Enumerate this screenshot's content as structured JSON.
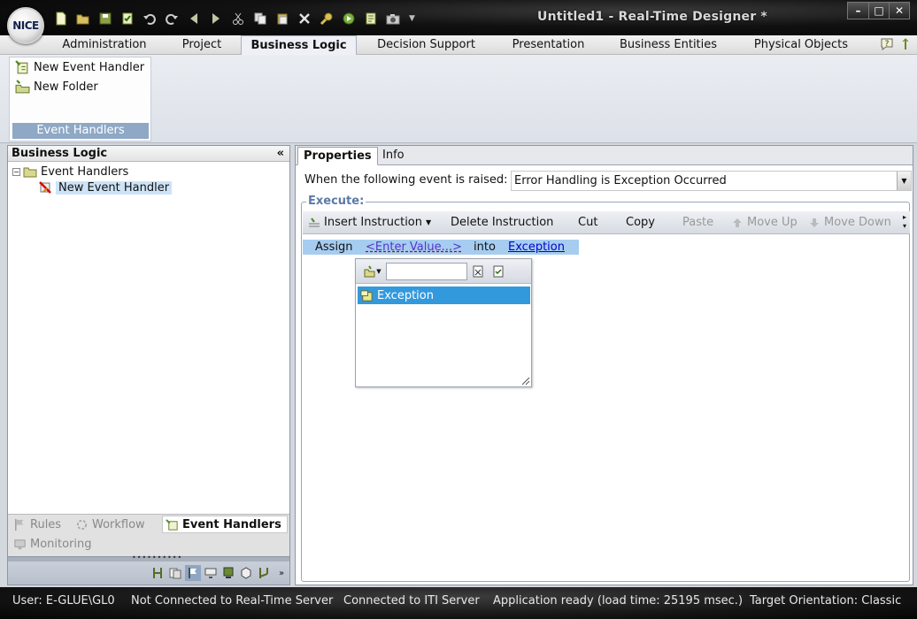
{
  "app": {
    "logo_text": "NICE",
    "window_title": "Untitled1 - Real-Time Designer *"
  },
  "quick_access": {
    "icons": [
      "new-icon",
      "open-icon",
      "save-icon",
      "check-icon",
      "undo-icon",
      "redo-icon",
      "back-icon",
      "forward-icon",
      "cut-icon",
      "copy-icon",
      "paste-icon",
      "delete-icon",
      "find-icon",
      "run-icon",
      "script-icon",
      "camera-icon"
    ]
  },
  "ribbon": {
    "tabs": [
      {
        "label": "Administration"
      },
      {
        "label": "Project"
      },
      {
        "label": "Business Logic"
      },
      {
        "label": "Decision Support"
      },
      {
        "label": "Presentation"
      },
      {
        "label": "Business Entities"
      },
      {
        "label": "Physical Objects"
      }
    ],
    "active_tab": "Business Logic",
    "group": {
      "items": [
        {
          "label": "New Event Handler"
        },
        {
          "label": "New Folder"
        }
      ],
      "label": "Event Handlers"
    }
  },
  "left_panel": {
    "title": "Business Logic",
    "collapse_glyph": "«",
    "tree": {
      "root_expander": "−",
      "root_label": "Event Handlers",
      "child_label": "New Event Handler"
    },
    "nav": {
      "rules": "Rules",
      "workflow": "Workflow",
      "event_handlers": "Event Handlers",
      "monitoring": "Monitoring"
    }
  },
  "right_panel": {
    "tabs": [
      {
        "label": "Properties"
      },
      {
        "label": "Info"
      }
    ],
    "active_tab": "Properties",
    "event_label": "When the following event is raised:",
    "event_value": "Error Handling is Exception Occurred",
    "execute_label": "Execute:",
    "toolbar": {
      "insert": "Insert Instruction",
      "delete": "Delete Instruction",
      "cut": "Cut",
      "copy": "Copy",
      "paste": "Paste",
      "move_up": "Move Up",
      "move_down": "Move Down"
    },
    "instruction": {
      "assign": "Assign",
      "enter_value": "<Enter Value...>",
      "into": "into",
      "target": "Exception"
    },
    "popup": {
      "search_value": "",
      "item": "Exception"
    }
  },
  "status_bar": {
    "user": "User: E-GLUE\\GL0",
    "rt_server": "Not Connected to Real-Time Server",
    "iti_server": "Connected to ITI Server",
    "app_status": "Application ready (load time: 25195 msec.)",
    "orientation": "Target Orientation: Classic"
  }
}
